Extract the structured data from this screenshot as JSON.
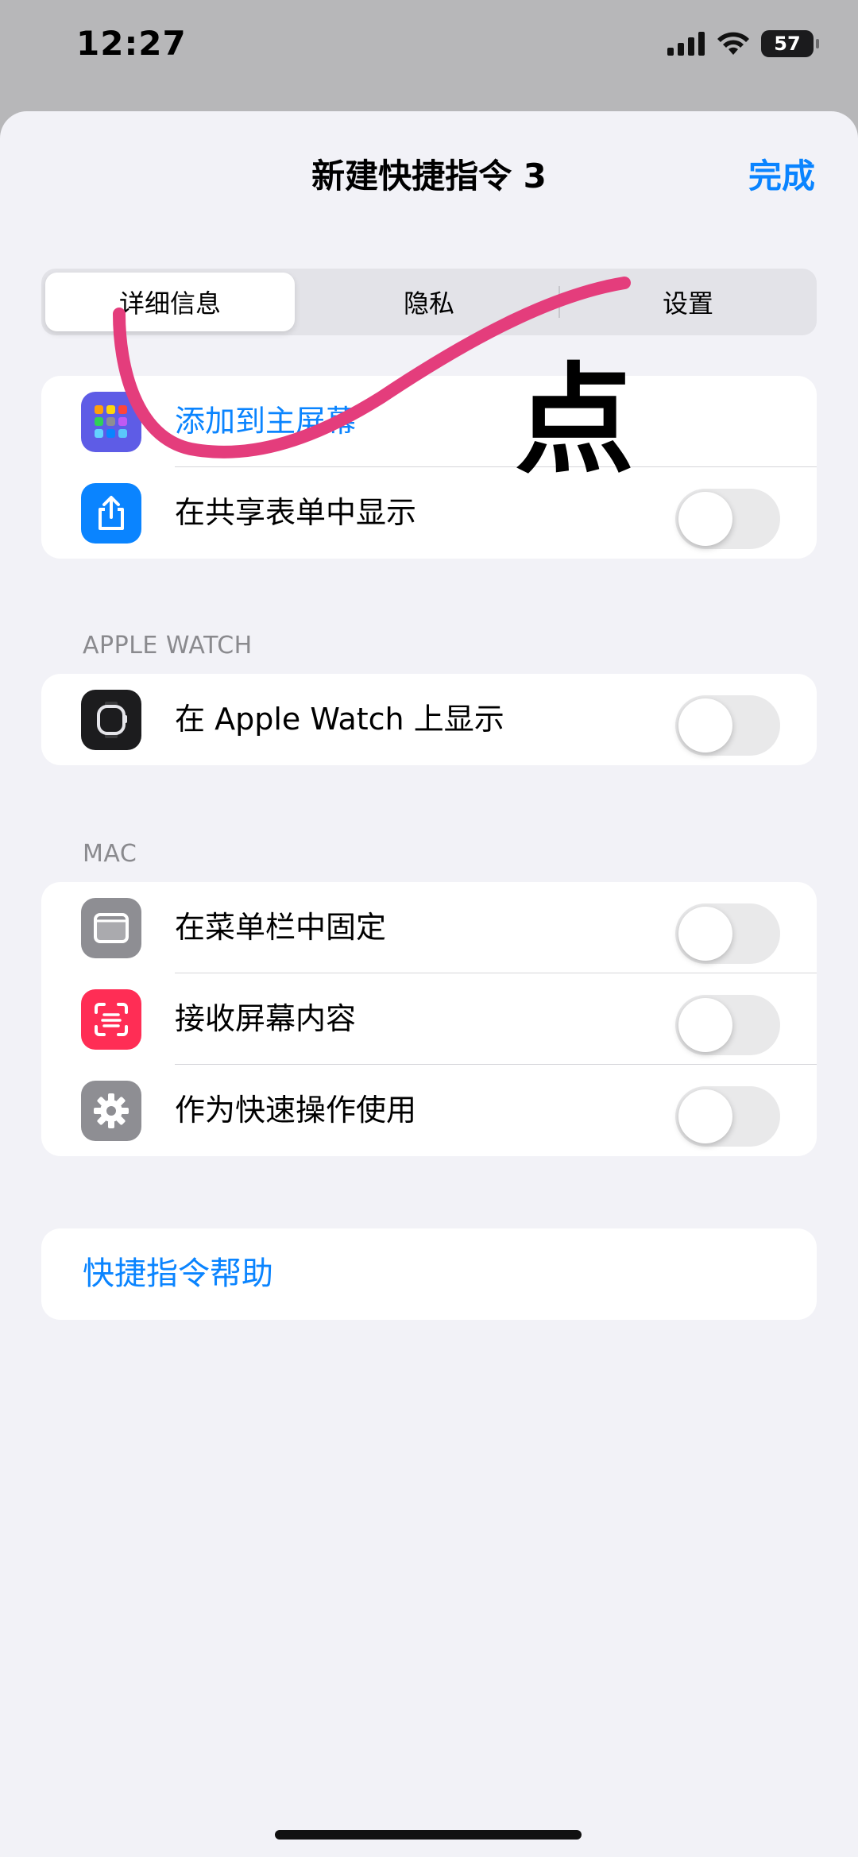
{
  "status_bar": {
    "time": "12:27",
    "battery": "57"
  },
  "nav": {
    "title": "新建快捷指令 3",
    "done": "完成"
  },
  "segments": [
    "详细信息",
    "隐私",
    "设置"
  ],
  "group1": {
    "add_home": "添加到主屏幕",
    "share_sheet": "在共享表单中显示"
  },
  "apple_watch": {
    "header": "APPLE WATCH",
    "show": "在 Apple Watch 上显示"
  },
  "mac": {
    "header": "MAC",
    "menu_bar": "在菜单栏中固定",
    "receive_screen": "接收屏幕内容",
    "quick_action": "作为快速操作使用"
  },
  "help": {
    "label": "快捷指令帮助"
  },
  "annotation": {
    "text": "点",
    "stroke_color": "#e43d7c"
  },
  "colors": {
    "accent": "#0a84ff",
    "share_icon": "#0a84ff",
    "screen_icon": "#ff2d55",
    "gray_icon": "#8e8e93"
  }
}
